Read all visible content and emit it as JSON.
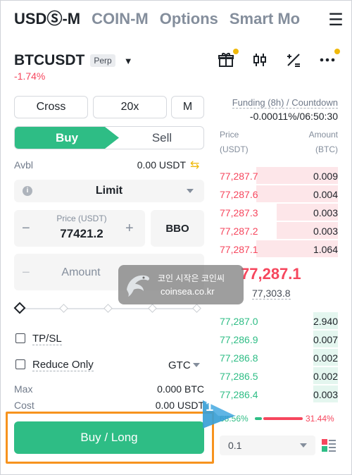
{
  "tabs": [
    "USDⓈ-M",
    "COIN-M",
    "Options",
    "Smart Mo"
  ],
  "tab_menu_icon": "hamburger-icon",
  "symbol": {
    "name": "BTCUSDT",
    "badge": "Perp",
    "change": "-1.74%"
  },
  "header_icons": [
    "gift-icon",
    "candlestick-icon",
    "calculator-icon",
    "more-icon"
  ],
  "margin": {
    "mode": "Cross",
    "leverage": "20x",
    "asset_mode": "M"
  },
  "side": {
    "buy": "Buy",
    "sell": "Sell"
  },
  "avbl": {
    "label": "Avbl",
    "value": "0.00 USDT"
  },
  "order_type": "Limit",
  "price": {
    "label": "Price (USDT)",
    "value": "77421.2",
    "bbo": "BBO"
  },
  "amount_placeholder": "Amount",
  "tpsl": "TP/SL",
  "reduce_only": "Reduce Only",
  "tif": "GTC",
  "max": {
    "label": "Max",
    "value": "0.000 BTC"
  },
  "cost": {
    "label": "Cost",
    "value": "0.00 USDT"
  },
  "buy_long": "Buy / Long",
  "funding": {
    "label": "Funding (8h) / Countdown",
    "value": "-0.00011%/06:50:30"
  },
  "orderbook": {
    "price_header": "Price",
    "price_unit": "(USDT)",
    "amount_header": "Amount",
    "amount_unit": "(BTC)",
    "asks": [
      {
        "price": "77,287.7",
        "amount": "0.009",
        "depth": 1.0
      },
      {
        "price": "77,287.6",
        "amount": "0.004",
        "depth": 1.0
      },
      {
        "price": "77,287.3",
        "amount": "0.003",
        "depth": 0.75
      },
      {
        "price": "77,287.2",
        "amount": "0.003",
        "depth": 0.75
      },
      {
        "price": "77,287.1",
        "amount": "1.064",
        "depth": 1.0
      }
    ],
    "mid_price": "77,287.1",
    "mark_price": "77,303.8",
    "bids": [
      {
        "price": "77,287.0",
        "amount": "2.940",
        "depth": 0.3
      },
      {
        "price": "77,286.9",
        "amount": "0.007",
        "depth": 0.3
      },
      {
        "price": "77,286.8",
        "amount": "0.002",
        "depth": 0.3
      },
      {
        "price": "77,286.5",
        "amount": "0.002",
        "depth": 0.3
      },
      {
        "price": "77,286.4",
        "amount": "0.003",
        "depth": 0.3
      }
    ],
    "buy_ratio": "68.56%",
    "sell_ratio": "31.44%",
    "depth_step": "0.1"
  },
  "callout_number": "1",
  "watermark": {
    "line1": "코인 시작은 코인씨",
    "line2": "coinsea.co.kr"
  },
  "colors": {
    "green": "#2ebd85",
    "red": "#f6465d",
    "yellow": "#f0b90b",
    "highlight": "#f7931e",
    "callout": "#3a9fd6"
  }
}
